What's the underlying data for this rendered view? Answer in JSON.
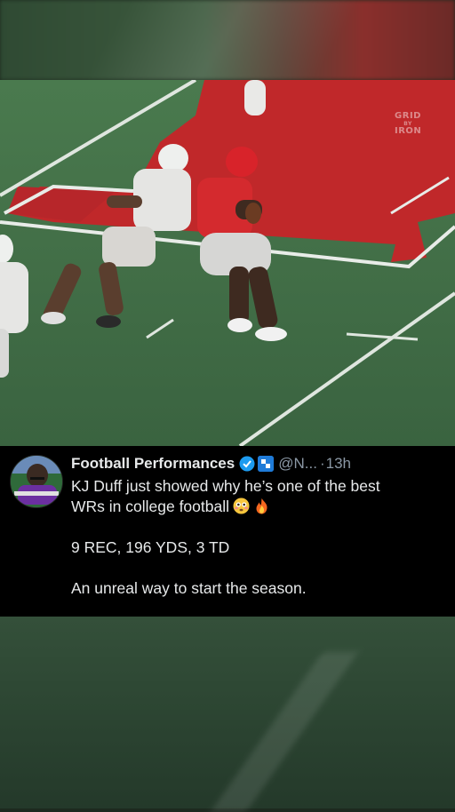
{
  "video": {
    "watermark_line1": "GRID",
    "watermark_line2": "BY",
    "watermark_line3": "IRON"
  },
  "tweet": {
    "author_name": "Football Performances",
    "handle": "@N...",
    "separator": "·",
    "time": "13h",
    "text_line1": "KJ Duff just showed why he’s one of the best",
    "text_line2": "WRs in college football",
    "emoji_1": "flushed-face-emoji",
    "emoji_2": "fire-emoji",
    "stat_line": "9 REC, 196 YDS, 3 TD",
    "closing_line": "An unreal way to start the season."
  },
  "colors": {
    "card_background": "#000000",
    "text_primary": "#e7e9ea",
    "text_secondary": "#8b98a5",
    "verified_blue": "#1d9bf0",
    "field_green": "#3e6a45",
    "endzone_red": "#c0282a"
  }
}
